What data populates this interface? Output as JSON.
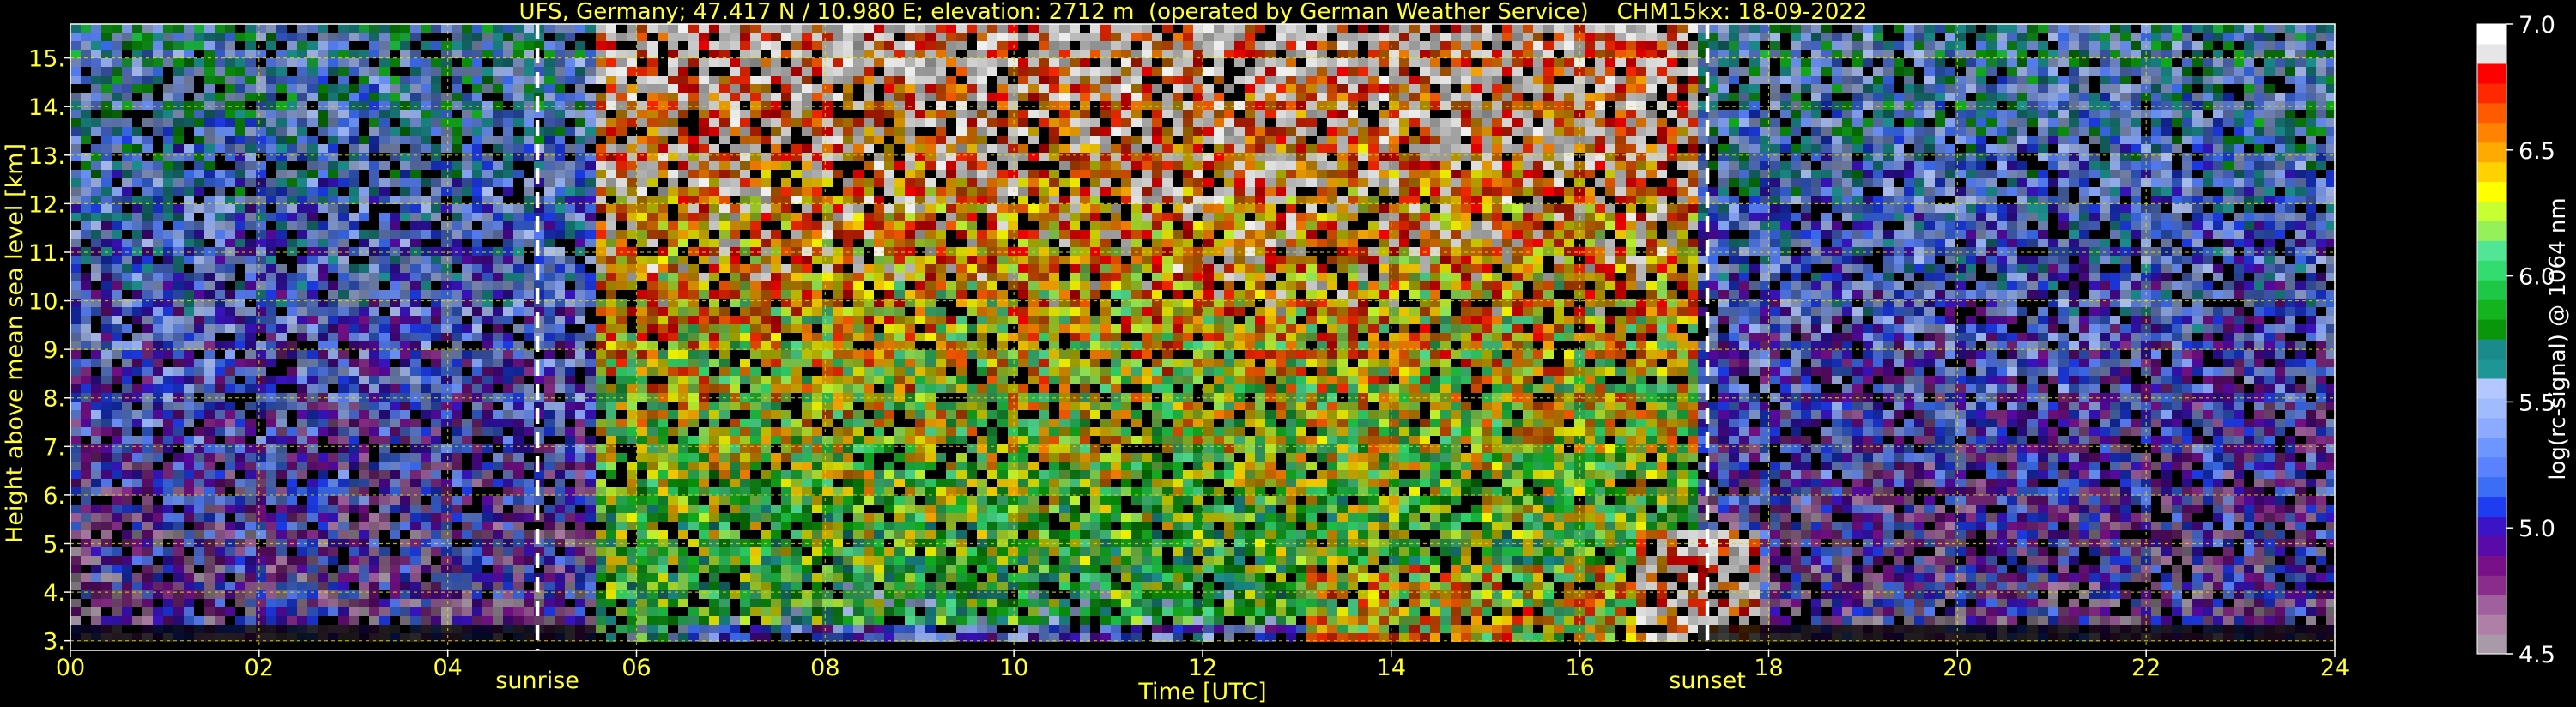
{
  "chart_data": {
    "type": "heatmap",
    "title": "UFS, Germany; 47.417 N / 10.980 E; elevation: 2712 m  (operated by German Weather Service)    CHM15kx: 18-09-2022",
    "xlabel": "Time [UTC]",
    "ylabel": "Height above mean sea level [km]",
    "xlim": [
      0,
      24
    ],
    "ylim": [
      2.8,
      15.7
    ],
    "x_ticks": [
      0,
      2,
      4,
      6,
      8,
      10,
      12,
      14,
      16,
      18,
      20,
      22,
      24
    ],
    "x_tick_labels": [
      "00",
      "02",
      "04",
      "06",
      "08",
      "10",
      "12",
      "14",
      "16",
      "18",
      "20",
      "22",
      "24"
    ],
    "y_ticks": [
      3,
      4,
      5,
      6,
      7,
      8,
      9,
      10,
      11,
      12,
      13,
      14,
      15
    ],
    "y_tick_labels": [
      "3.",
      "4.",
      "5.",
      "6.",
      "7.",
      "8.",
      "9.",
      "10.",
      "11.",
      "12.",
      "13.",
      "14.",
      "15."
    ],
    "grid": true,
    "markers": [
      {
        "label": "sunrise",
        "x": 4.95
      },
      {
        "label": "sunset",
        "x": 17.35
      }
    ],
    "colorbar": {
      "label": "log(rc-signal) @ 1064 nm",
      "range": [
        4.5,
        7.0
      ],
      "ticks": [
        4.5,
        5.0,
        5.5,
        6.0,
        6.5,
        7.0
      ],
      "tick_labels": [
        "4.5",
        "5.0",
        "5.5",
        "6.0",
        "6.5",
        "7.0"
      ],
      "colors": [
        "#a89aa8",
        "#b07fa8",
        "#a0609e",
        "#8a2d8a",
        "#78108a",
        "#5a0aa8",
        "#3c14c8",
        "#1e3cf0",
        "#3c6ef5",
        "#5a82ff",
        "#6e96ff",
        "#8caaff",
        "#a0bcff",
        "#b4c8ff",
        "#1e9696",
        "#1a8a8a",
        "#0a960a",
        "#14b41e",
        "#1ec846",
        "#32dc6e",
        "#50e696",
        "#96f05a",
        "#c8ff32",
        "#ffff00",
        "#ffd200",
        "#ffaa00",
        "#ff8200",
        "#ff5a00",
        "#ff2800",
        "#ff0000",
        "#e6e6e6",
        "#ffffff"
      ]
    }
  },
  "colors": {
    "axis_text": "#ffff33",
    "grid": "#dddd00",
    "marker_line": "#ffffff"
  }
}
